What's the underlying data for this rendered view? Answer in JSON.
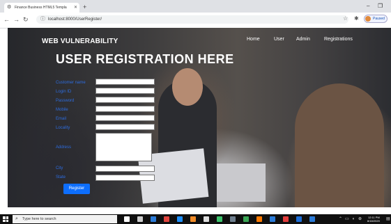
{
  "browser": {
    "tab_title": "Finance Business HTML5 Templa",
    "new_tab": "+",
    "url": "localhost:8000/UserRegister/",
    "profile_status": "Paused",
    "minimize": "–",
    "restore": "❐"
  },
  "site": {
    "brand": "WEB VULNERABILITY",
    "nav": [
      "Home",
      "User",
      "Admin",
      "Registrations"
    ],
    "heading": "USER REGISTRATION HERE"
  },
  "form": {
    "fields": [
      "Customer name",
      "Login ID",
      "Password",
      "Mobile",
      "Email",
      "Locality"
    ],
    "address_label": "Address",
    "city_label": "City",
    "state_label": "State",
    "submit": "Register"
  },
  "taskbar": {
    "search_placeholder": "Type here to search",
    "time": "12:11 PM",
    "date": "8/18/2020",
    "icon_colors": [
      "#ffffff",
      "#cccccc",
      "#2b7bd8",
      "#e0443e",
      "#1e90ff",
      "#f28c28",
      "#dddddd",
      "#3ec46d",
      "#6f7f8f",
      "#3aa655",
      "#ff7a00",
      "#2b7bd8",
      "#e23c3c",
      "#1e6fd9",
      "#2b7bd8"
    ]
  }
}
